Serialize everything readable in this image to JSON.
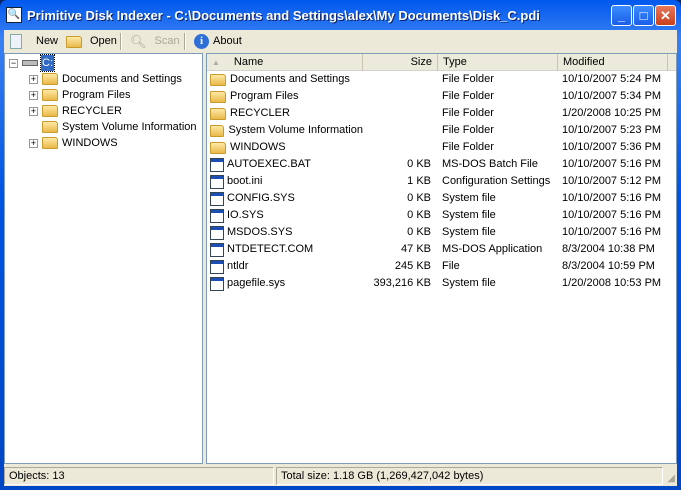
{
  "window": {
    "title": "Primitive Disk Indexer - C:\\Documents and Settings\\alex\\My Documents\\Disk_C.pdi",
    "minimize": "_",
    "maximize": "□",
    "close": "✕"
  },
  "toolbar": {
    "new": "New",
    "open": "Open",
    "scan": "Scan",
    "about": "About"
  },
  "tree": {
    "root": "C:",
    "items": [
      {
        "label": "Documents and Settings",
        "expandable": true
      },
      {
        "label": "Program Files",
        "expandable": true
      },
      {
        "label": "RECYCLER",
        "expandable": true
      },
      {
        "label": "System Volume Information",
        "expandable": false
      },
      {
        "label": "WINDOWS",
        "expandable": true
      }
    ]
  },
  "list": {
    "columns": [
      "Name",
      "Size",
      "Type",
      "Modified"
    ],
    "rows": [
      {
        "name": "Documents and Settings",
        "size": "",
        "type": "File Folder",
        "modified": "10/10/2007 5:24 PM",
        "icon": "folder"
      },
      {
        "name": "Program Files",
        "size": "",
        "type": "File Folder",
        "modified": "10/10/2007 5:34 PM",
        "icon": "folder"
      },
      {
        "name": "RECYCLER",
        "size": "",
        "type": "File Folder",
        "modified": "1/20/2008 10:25 PM",
        "icon": "folder"
      },
      {
        "name": "System Volume Information",
        "size": "",
        "type": "File Folder",
        "modified": "10/10/2007 5:23 PM",
        "icon": "folder"
      },
      {
        "name": "WINDOWS",
        "size": "",
        "type": "File Folder",
        "modified": "10/10/2007 5:36 PM",
        "icon": "folder"
      },
      {
        "name": "AUTOEXEC.BAT",
        "size": "0 KB",
        "type": "MS-DOS Batch File",
        "modified": "10/10/2007 5:16 PM",
        "icon": "batch"
      },
      {
        "name": "boot.ini",
        "size": "1 KB",
        "type": "Configuration Settings",
        "modified": "10/10/2007 5:12 PM",
        "icon": "config"
      },
      {
        "name": "CONFIG.SYS",
        "size": "0 KB",
        "type": "System file",
        "modified": "10/10/2007 5:16 PM",
        "icon": "system"
      },
      {
        "name": "IO.SYS",
        "size": "0 KB",
        "type": "System file",
        "modified": "10/10/2007 5:16 PM",
        "icon": "system"
      },
      {
        "name": "MSDOS.SYS",
        "size": "0 KB",
        "type": "System file",
        "modified": "10/10/2007 5:16 PM",
        "icon": "system"
      },
      {
        "name": "NTDETECT.COM",
        "size": "47 KB",
        "type": "MS-DOS Application",
        "modified": "8/3/2004 10:38 PM",
        "icon": "app"
      },
      {
        "name": "ntldr",
        "size": "245 KB",
        "type": "File",
        "modified": "8/3/2004 10:59 PM",
        "icon": "system"
      },
      {
        "name": "pagefile.sys",
        "size": "393,216 KB",
        "type": "System file",
        "modified": "1/20/2008 10:53 PM",
        "icon": "system"
      }
    ]
  },
  "status": {
    "objects": "Objects: 13",
    "total": "Total size: 1.18 GB (1,269,427,042 bytes)"
  }
}
